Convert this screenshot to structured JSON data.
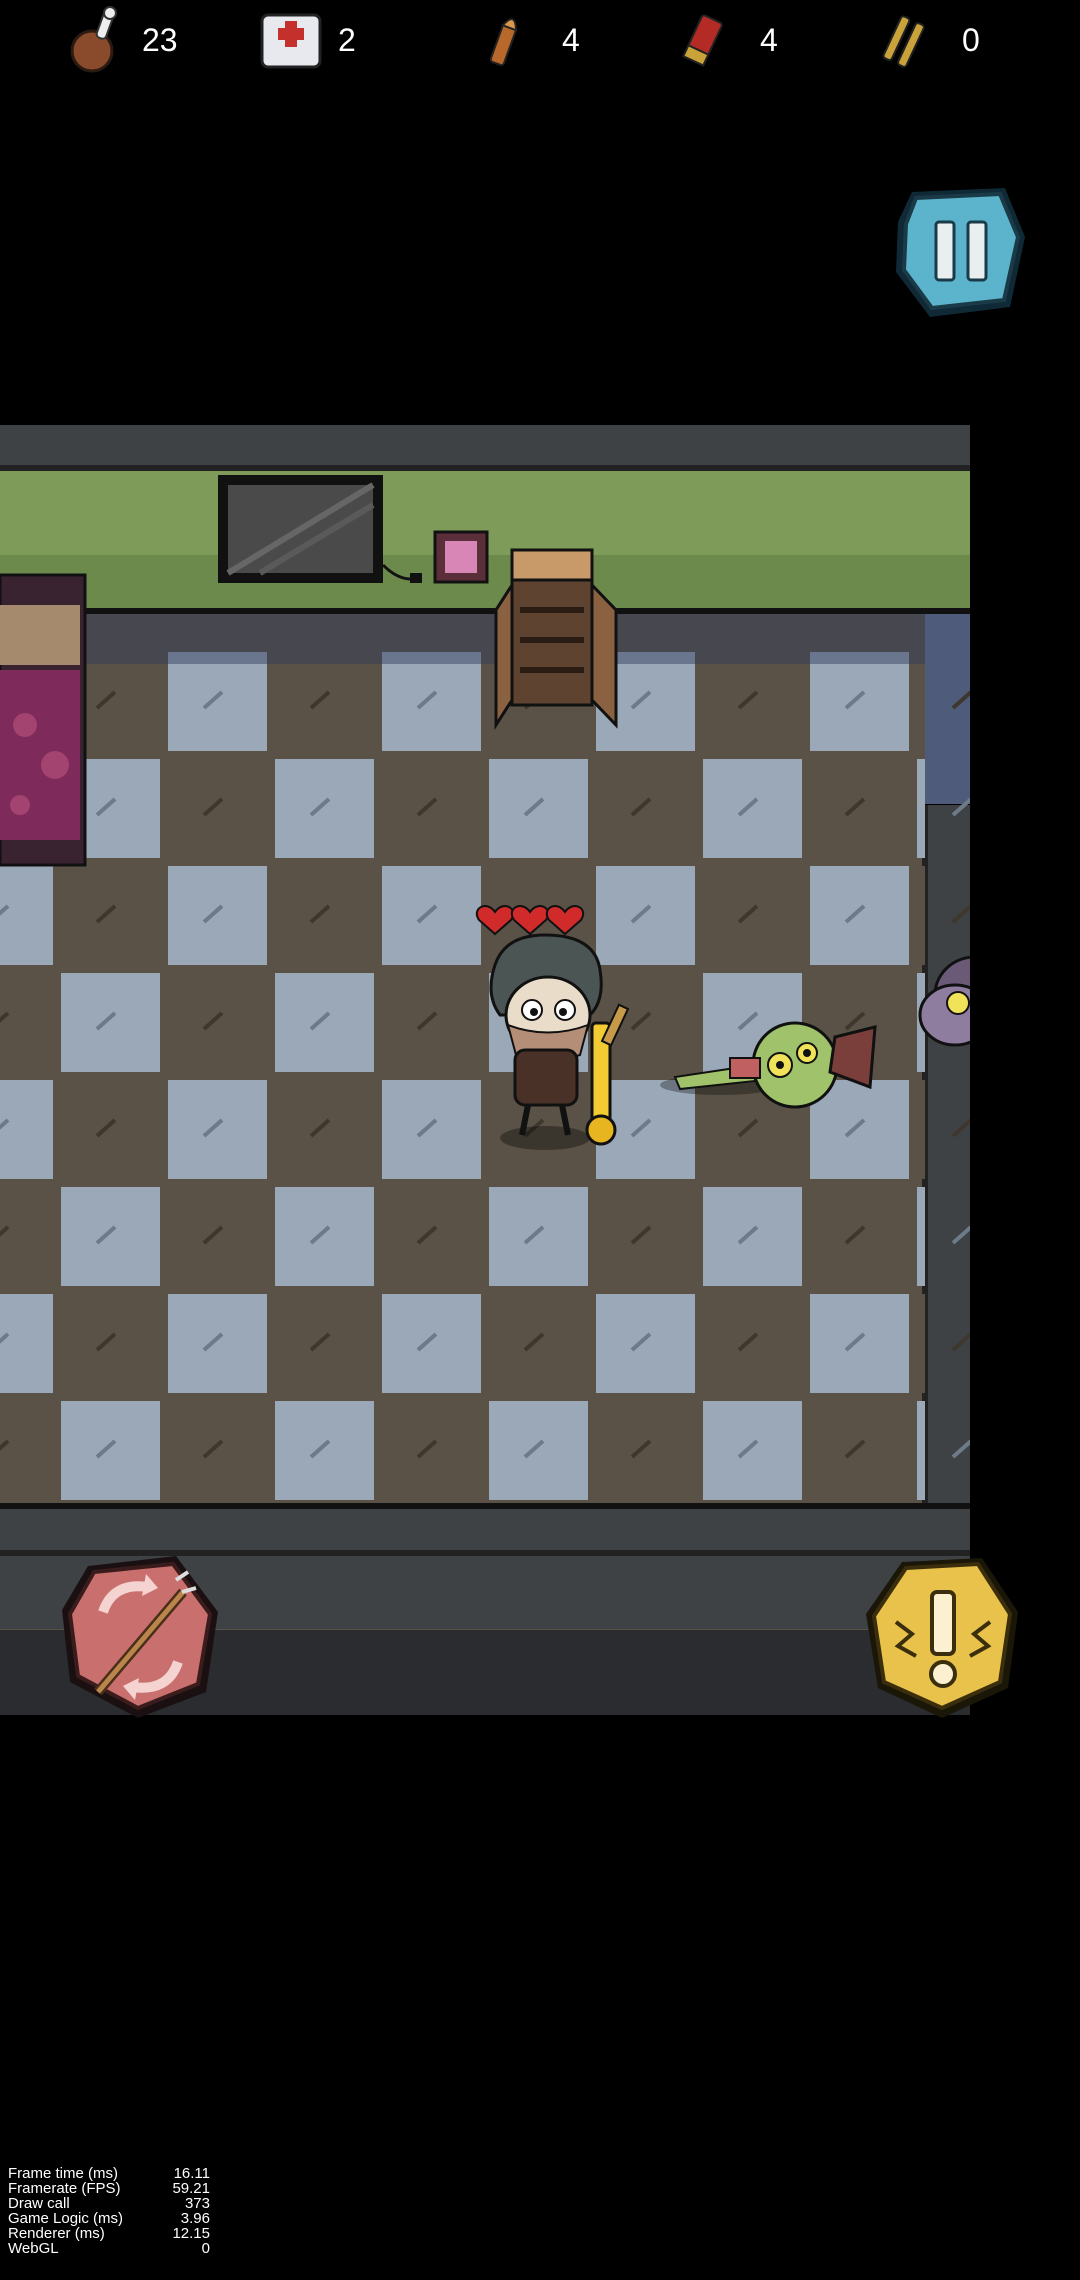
{
  "hud": {
    "resources": [
      {
        "name": "food",
        "icon": "meat-drumstick-icon",
        "count": "23"
      },
      {
        "name": "medkit",
        "icon": "medkit-icon",
        "count": "2"
      },
      {
        "name": "pistol-ammo",
        "icon": "bullet-icon",
        "count": "4"
      },
      {
        "name": "shotgun-shells",
        "icon": "shotgun-shell-icon",
        "count": "4"
      },
      {
        "name": "rifle-ammo",
        "icon": "rifle-bullets-icon",
        "count": "0"
      }
    ]
  },
  "player": {
    "hearts": 3
  },
  "stats": [
    {
      "label": "Frame time (ms)",
      "value": "16.11"
    },
    {
      "label": "Framerate (FPS)",
      "value": "59.21"
    },
    {
      "label": "Draw call",
      "value": "373"
    },
    {
      "label": "Game Logic (ms)",
      "value": "3.96"
    },
    {
      "label": "Renderer (ms)",
      "value": "12.15"
    },
    {
      "label": "WebGL",
      "value": "0"
    }
  ],
  "colors": {
    "pause": "#5bb4cc",
    "action_left": "#c9706f",
    "action_right": "#e8c24a",
    "wall": "#7f9b5a"
  }
}
